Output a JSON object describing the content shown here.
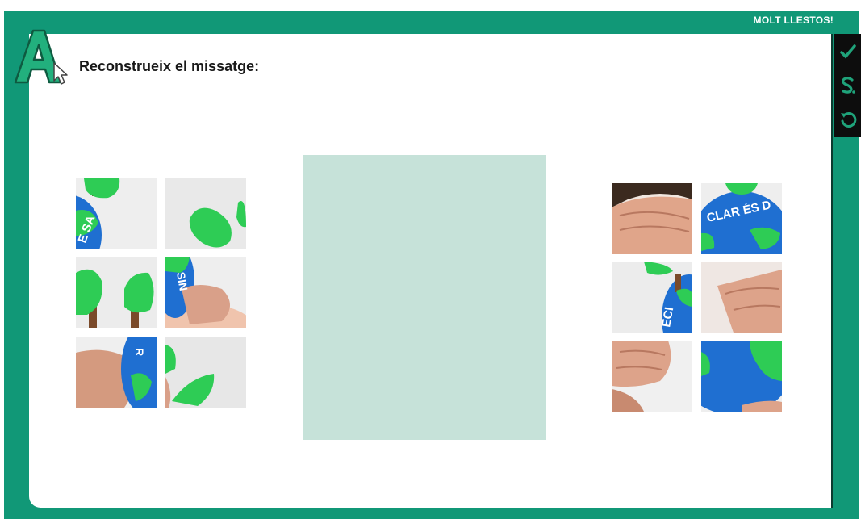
{
  "header": {
    "badge_text": "MOLT LLESTOS!"
  },
  "instruction": {
    "text": "Reconstrueix el missatge:"
  },
  "toolbar": {
    "buttons": [
      {
        "name": "check-icon"
      },
      {
        "name": "solution-icon"
      },
      {
        "name": "reset-icon"
      }
    ]
  },
  "puzzle": {
    "drop_zone_color": "#c6e2d9",
    "left_tiles": [
      {
        "id": "L1",
        "text": "E SA"
      },
      {
        "id": "L2",
        "text": ""
      },
      {
        "id": "L3",
        "text": ""
      },
      {
        "id": "L4",
        "text": "SIN"
      },
      {
        "id": "L5",
        "text": "R"
      },
      {
        "id": "L6",
        "text": ""
      }
    ],
    "right_tiles": [
      {
        "id": "R1",
        "text": ""
      },
      {
        "id": "R2",
        "text": "CLAR ÉS D"
      },
      {
        "id": "R3",
        "text": "ECI"
      },
      {
        "id": "R4",
        "text": ""
      },
      {
        "id": "R5",
        "text": ""
      },
      {
        "id": "R6",
        "text": ""
      }
    ]
  },
  "colors": {
    "frame": "#119877",
    "toolbar": "#0d0d0d",
    "globe_blue": "#1f6fd1",
    "clay_green": "#2ecc55",
    "skin": "#d9a089"
  }
}
